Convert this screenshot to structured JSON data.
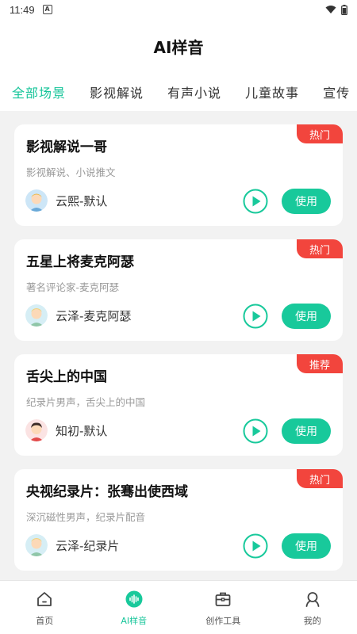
{
  "status_bar": {
    "time": "11:49",
    "notif_icon": "a-icon"
  },
  "header": {
    "title": "AI样音"
  },
  "tabs": [
    {
      "label": "全部场景",
      "active": true
    },
    {
      "label": "影视解说",
      "active": false
    },
    {
      "label": "有声小说",
      "active": false
    },
    {
      "label": "儿童故事",
      "active": false
    },
    {
      "label": "宣传",
      "active": false
    }
  ],
  "cards": [
    {
      "title": "影视解说一哥",
      "desc": "影视解说、小说推文",
      "badge": "热门",
      "voice": "云熙-默认",
      "use_label": "使用"
    },
    {
      "title": "五星上将麦克阿瑟",
      "desc": "著名评论家-麦克阿瑟",
      "badge": "热门",
      "voice": "云泽-麦克阿瑟",
      "use_label": "使用"
    },
    {
      "title": "舌尖上的中国",
      "desc": "纪录片男声，舌尖上的中国",
      "badge": "推荐",
      "voice": "知初-默认",
      "use_label": "使用"
    },
    {
      "title": "央视纪录片：张骞出使西域",
      "desc": "深沉磁性男声，纪录片配音",
      "badge": "热门",
      "voice": "云泽-纪录片",
      "use_label": "使用"
    }
  ],
  "bottom_nav": [
    {
      "label": "首页",
      "icon": "home-icon",
      "active": false
    },
    {
      "label": "AI样音",
      "icon": "sound-wave-icon",
      "active": true
    },
    {
      "label": "创作工具",
      "icon": "toolbox-icon",
      "active": false
    },
    {
      "label": "我的",
      "icon": "profile-icon",
      "active": false
    }
  ],
  "colors": {
    "accent": "#18c99b",
    "badge": "#f2453d",
    "background": "#f2f2f2"
  }
}
